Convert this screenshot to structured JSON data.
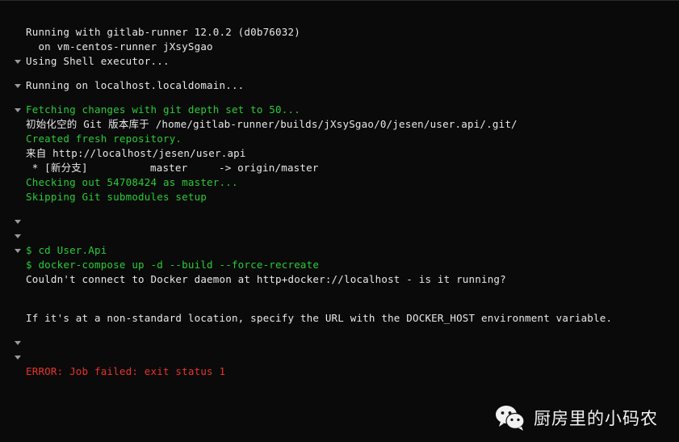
{
  "terminal": {
    "background_color": "#0a0a0a",
    "text_color": "#e8e8e8",
    "green_color": "#29cc36",
    "red_color": "#e8342a",
    "arrow_color": "#9a9a9a",
    "lines": [
      {
        "arrow": false,
        "color": "white",
        "text": "Running with gitlab-runner 12.0.2 (d0b76032)"
      },
      {
        "arrow": false,
        "color": "white",
        "text": "  on vm-centos-runner jXsySgao"
      },
      {
        "arrow": true,
        "color": "white",
        "text": "Using Shell executor..."
      },
      {
        "arrow": true,
        "color": "white",
        "text": "Running on localhost.localdomain..."
      },
      {
        "arrow": true,
        "color": "green",
        "text": "Fetching changes with git depth set to 50..."
      },
      {
        "arrow": false,
        "color": "white",
        "text": "初始化空的 Git 版本库于 /home/gitlab-runner/builds/jXsySgao/0/jesen/user.api/.git/"
      },
      {
        "arrow": false,
        "color": "green",
        "text": "Created fresh repository."
      },
      {
        "arrow": false,
        "color": "white",
        "text": "来自 http://localhost/jesen/user.api"
      },
      {
        "arrow": false,
        "color": "white",
        "text": " * [新分支]          master     -> origin/master"
      },
      {
        "arrow": false,
        "color": "green",
        "text": "Checking out 54708424 as master..."
      },
      {
        "arrow": false,
        "color": "green",
        "text": "Skipping Git submodules setup"
      },
      {
        "arrow": true,
        "color": "white",
        "text": ""
      },
      {
        "arrow": true,
        "color": "white",
        "text": ""
      },
      {
        "arrow": true,
        "color": "green",
        "text": "$ cd User.Api"
      },
      {
        "arrow": false,
        "color": "green",
        "text": "$ docker-compose up -d --build --force-recreate"
      },
      {
        "arrow": false,
        "color": "white",
        "text": "Couldn't connect to Docker daemon at http+docker://localhost - is it running?"
      },
      {
        "arrow": false,
        "color": "white",
        "text": ""
      },
      {
        "arrow": false,
        "color": "white",
        "text": "If it's at a non-standard location, specify the URL with the DOCKER_HOST environment variable."
      },
      {
        "arrow": true,
        "color": "white",
        "text": ""
      },
      {
        "arrow": true,
        "color": "white",
        "text": ""
      },
      {
        "arrow": false,
        "color": "red",
        "text": "ERROR: Job failed: exit status 1"
      }
    ]
  },
  "watermark": {
    "icon": "wechat-icon",
    "account_name": "厨房里的小码农"
  }
}
